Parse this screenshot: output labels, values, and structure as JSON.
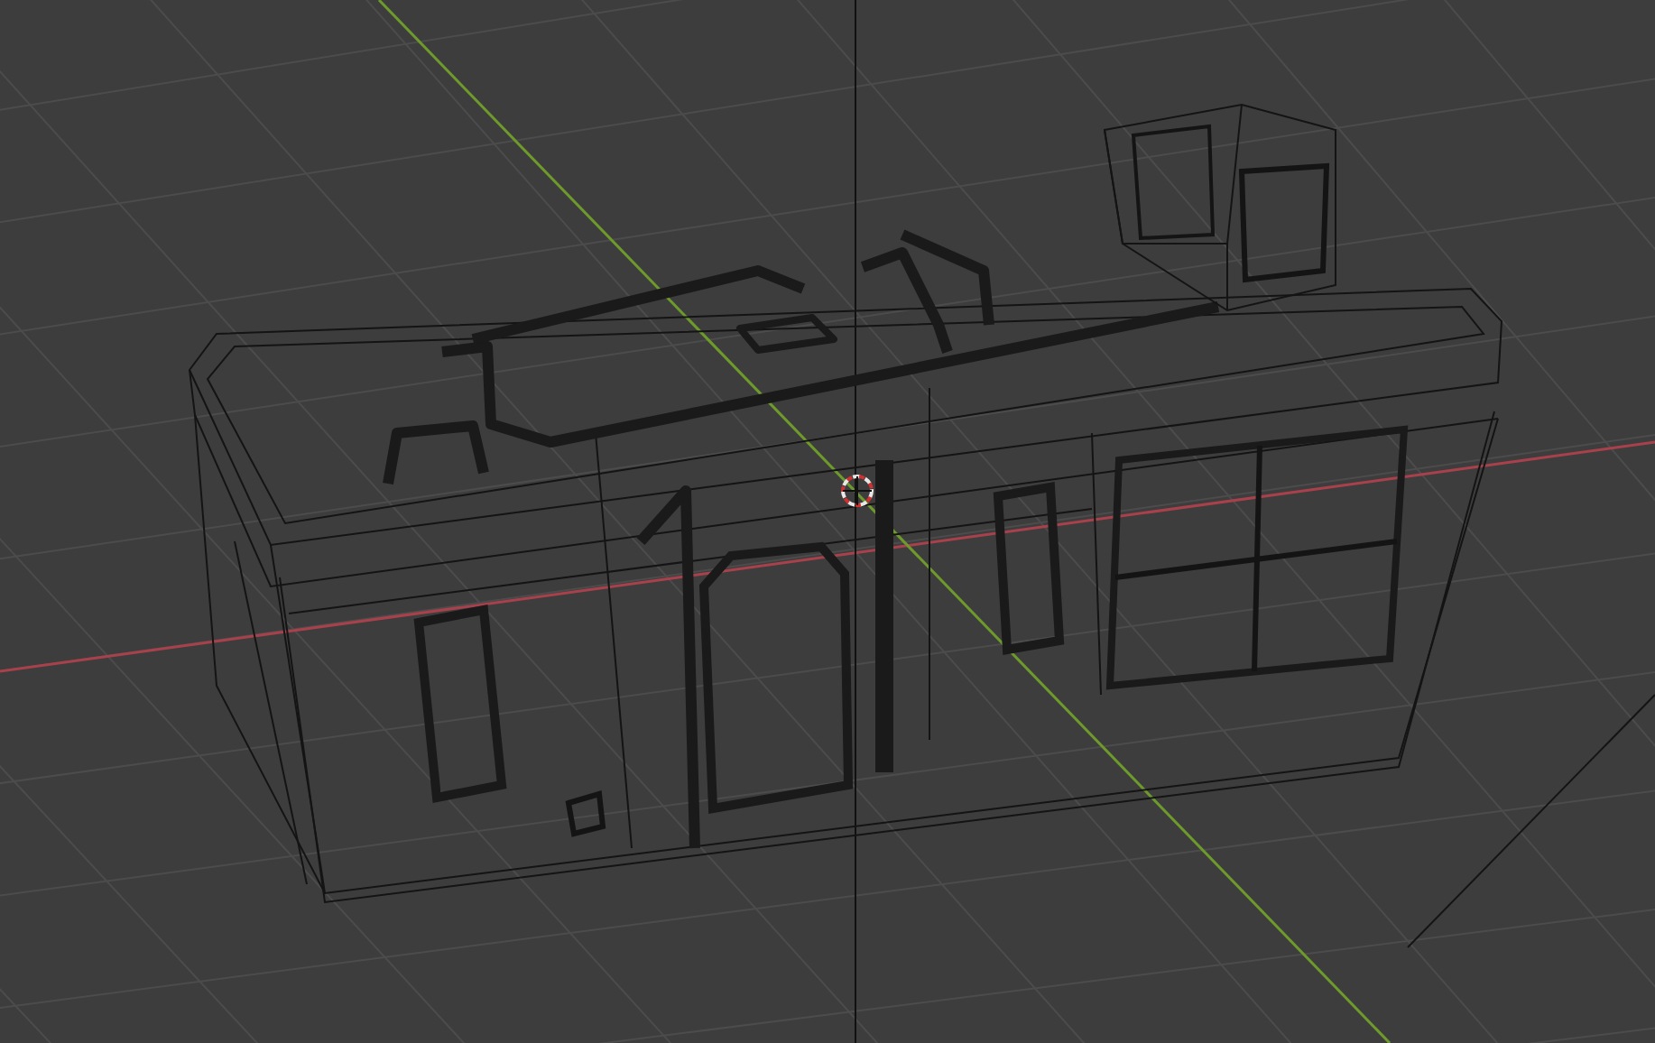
{
  "viewport": {
    "wireframe": true,
    "grid": true,
    "axes": true,
    "cursor": true
  }
}
